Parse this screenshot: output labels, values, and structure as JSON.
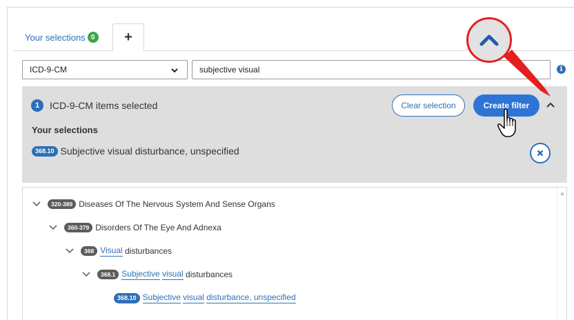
{
  "tabs": {
    "selections_label": "Your selections",
    "selections_count": "0",
    "add_label": "+"
  },
  "search": {
    "code_system": "ICD-9-CM",
    "query": "subjective visual",
    "info": "i"
  },
  "panel": {
    "count": "1",
    "title": "ICD-9-CM items selected",
    "clear_label": "Clear selection",
    "create_label": "Create filter",
    "selections_header": "Your selections",
    "item_code": "368.10",
    "item_label": "Subjective visual disturbance, unspecified"
  },
  "tree": {
    "row1": {
      "code": "320-389",
      "label": "Diseases Of The Nervous System And Sense Organs"
    },
    "row2": {
      "code": "360-379",
      "label": "Disorders Of The Eye And Adnexa"
    },
    "row3": {
      "code": "368",
      "hl1": "Visual",
      "rest": " disturbances"
    },
    "row4": {
      "code": "368.1",
      "hl1": "Subjective",
      "hl2": "visual",
      "rest": " disturbances"
    },
    "row5": {
      "code": "368.10",
      "hl1": "Subjective",
      "hl2": "visual",
      "hl3": "disturbance, unspecified"
    }
  },
  "colors": {
    "accent": "#2d6fb7",
    "button": "#2e74d4",
    "badge_green": "#3aa64b",
    "annotation_red": "#e51f1f",
    "panel_bg": "#dedede"
  }
}
